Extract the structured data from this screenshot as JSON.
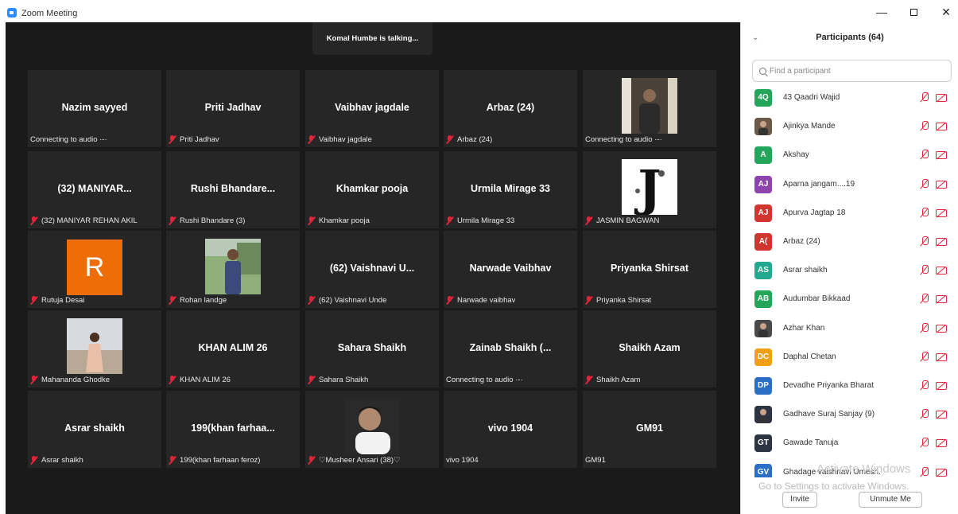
{
  "window": {
    "title": "Zoom Meeting",
    "minimize": "—",
    "close": "✕"
  },
  "meeting": {
    "talking_banner": "Komal Humbe is talking...",
    "tiles": [
      {
        "name": "Nazim sayyed",
        "label": "Connecting to audio ·-·",
        "muted": false,
        "kind": "name"
      },
      {
        "name": "Priti Jadhav",
        "label": "Priti Jadhav",
        "muted": true,
        "kind": "name"
      },
      {
        "name": "Vaibhav jagdale",
        "label": "Vaibhav jagdale",
        "muted": true,
        "kind": "name"
      },
      {
        "name": "Arbaz (24)",
        "label": "Arbaz (24)",
        "muted": true,
        "kind": "name"
      },
      {
        "name": "",
        "label": "Connecting to audio ·-·",
        "muted": false,
        "kind": "photo-man"
      },
      {
        "name": "(32) MANIYAR...",
        "label": "(32) MANIYAR REHAN AKIL",
        "muted": true,
        "kind": "name"
      },
      {
        "name": "Rushi Bhandare...",
        "label": "Rushi Bhandare (3)",
        "muted": true,
        "kind": "name"
      },
      {
        "name": "Khamkar pooja",
        "label": "Khamkar pooja",
        "muted": true,
        "kind": "name"
      },
      {
        "name": "Urmila Mirage 33",
        "label": "Urmila Mirage 33",
        "muted": true,
        "kind": "name"
      },
      {
        "name": "",
        "label": "JASMIN BAGWAN",
        "muted": true,
        "kind": "photo-j"
      },
      {
        "name": "R",
        "label": "Rutuja Desai",
        "muted": true,
        "kind": "avatar-r"
      },
      {
        "name": "",
        "label": "Rohan landge",
        "muted": true,
        "kind": "photo-field"
      },
      {
        "name": "(62) Vaishnavi U...",
        "label": "(62) Vaishnavi Unde",
        "muted": true,
        "kind": "name"
      },
      {
        "name": "Narwade Vaibhav",
        "label": "Narwade vaibhav",
        "muted": true,
        "kind": "name"
      },
      {
        "name": "Priyanka Shirsat",
        "label": "Priyanka Shirsat",
        "muted": true,
        "kind": "name"
      },
      {
        "name": "",
        "label": "Mahananda Ghodke",
        "muted": true,
        "kind": "photo-girl"
      },
      {
        "name": "KHAN ALIM 26",
        "label": "KHAN ALIM 26",
        "muted": true,
        "kind": "name"
      },
      {
        "name": "Sahara Shaikh",
        "label": "Sahara Shaikh",
        "muted": true,
        "kind": "name"
      },
      {
        "name": "Zainab Shaikh (...",
        "label": "Connecting to audio ·-·",
        "muted": false,
        "kind": "name"
      },
      {
        "name": "Shaikh Azam",
        "label": "Shaikh Azam",
        "muted": true,
        "kind": "name"
      },
      {
        "name": "Asrar shaikh",
        "label": "Asrar shaikh",
        "muted": true,
        "kind": "name"
      },
      {
        "name": "199(khan farhaa...",
        "label": "199(khan farhaan feroz)",
        "muted": true,
        "kind": "name"
      },
      {
        "name": "",
        "label": "♡Musheer Ansari (38)♡",
        "muted": true,
        "kind": "photo-actor"
      },
      {
        "name": "vivo 1904",
        "label": "vivo 1904",
        "muted": false,
        "kind": "name"
      },
      {
        "name": "GM91",
        "label": "GM91",
        "muted": false,
        "kind": "name"
      }
    ]
  },
  "participants": {
    "title": "Participants (64)",
    "search_placeholder": "Find a participant",
    "list": [
      {
        "initials": "4Q",
        "name": "43 Qaadri Wajid",
        "color": "#23a55a",
        "photo": false
      },
      {
        "initials": "",
        "name": "Ajinkya Mande",
        "color": "#6b5a48",
        "photo": true
      },
      {
        "initials": "A",
        "name": "Akshay",
        "color": "#23a55a",
        "photo": false
      },
      {
        "initials": "AJ",
        "name": "Aparna jangam....19",
        "color": "#8e44ad",
        "photo": false
      },
      {
        "initials": "AJ",
        "name": "Apurva Jagtap 18",
        "color": "#d0362f",
        "photo": false
      },
      {
        "initials": "A(",
        "name": "Arbaz (24)",
        "color": "#d0362f",
        "photo": false
      },
      {
        "initials": "AS",
        "name": "Asrar shaikh",
        "color": "#21a88f",
        "photo": false
      },
      {
        "initials": "AB",
        "name": "Audumbar Bikkaad",
        "color": "#23a55a",
        "photo": false
      },
      {
        "initials": "",
        "name": "Azhar Khan",
        "color": "#4a4a4a",
        "photo": true
      },
      {
        "initials": "DC",
        "name": "Daphal Chetan",
        "color": "#f0a017",
        "photo": false
      },
      {
        "initials": "DP",
        "name": "Devadhe Priyanka Bharat",
        "color": "#2a6fc4",
        "photo": false
      },
      {
        "initials": "",
        "name": "Gadhave Suraj Sanjay (9)",
        "color": "#2b3440",
        "photo": true
      },
      {
        "initials": "GT",
        "name": "Gawade Tanuja",
        "color": "#2b3440",
        "photo": false
      },
      {
        "initials": "GV",
        "name": "Ghadage vaishnavi Umesh.",
        "color": "#2a6fc4",
        "photo": false
      }
    ],
    "watermark_line1": "Activate Windows",
    "watermark_line2": "Go to Settings to activate Windows.",
    "invite_label": "Invite",
    "unmute_label": "Unmute Me"
  }
}
